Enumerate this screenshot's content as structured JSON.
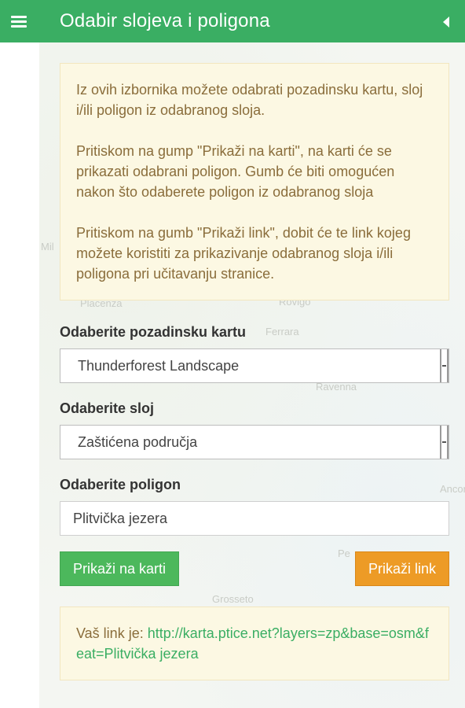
{
  "header": {
    "title": "Odabir slojeva i poligona",
    "menu_icon": "hamburger-menu-icon",
    "collapse_icon": "caret-left-icon",
    "color": "#3aae63"
  },
  "map_labels": [
    "Placenza",
    "Rovigo",
    "Ferrara",
    "Ravenna",
    "Grosseto",
    "Ancona",
    "Mil",
    "Pe"
  ],
  "info": {
    "paragraphs": [
      "Iz ovih izbornika možete odabrati pozadinsku kartu, sloj i/ili poligon iz odabranog sloja.",
      "Pritiskom na gump \"Prikaži na karti\", na karti će se prikazati odabrani poligon. Gumb će biti omogućen nakon što odaberete poligon iz odabranog sloja",
      "Pritiskom na gumb \"Prikaži link\", dobit će te link kojeg možete koristiti za prikazivanje odabranog sloja i/ili poligona pri učitavanju stranice."
    ]
  },
  "form": {
    "base_map_label": "Odaberite pozadinsku kartu",
    "base_map_value": "Thunderforest Landscape",
    "layer_label": "Odaberite sloj",
    "layer_value": "Zaštićena područja",
    "polygon_label": "Odaberite poligon",
    "polygon_value": "Plitvička jezera"
  },
  "buttons": {
    "show_on_map": "Prikaži na karti",
    "show_link": "Prikaži link"
  },
  "link": {
    "prefix": "Vaš link je: ",
    "url": "http://karta.ptice.net?layers=zp&base=osm&feat=Plitvička jezera"
  },
  "colors": {
    "accent_green": "#3aae63",
    "button_green": "#4cb85c",
    "button_orange": "#ed9b26",
    "info_background": "#fcf8e3",
    "info_text": "#8a6d3b"
  }
}
